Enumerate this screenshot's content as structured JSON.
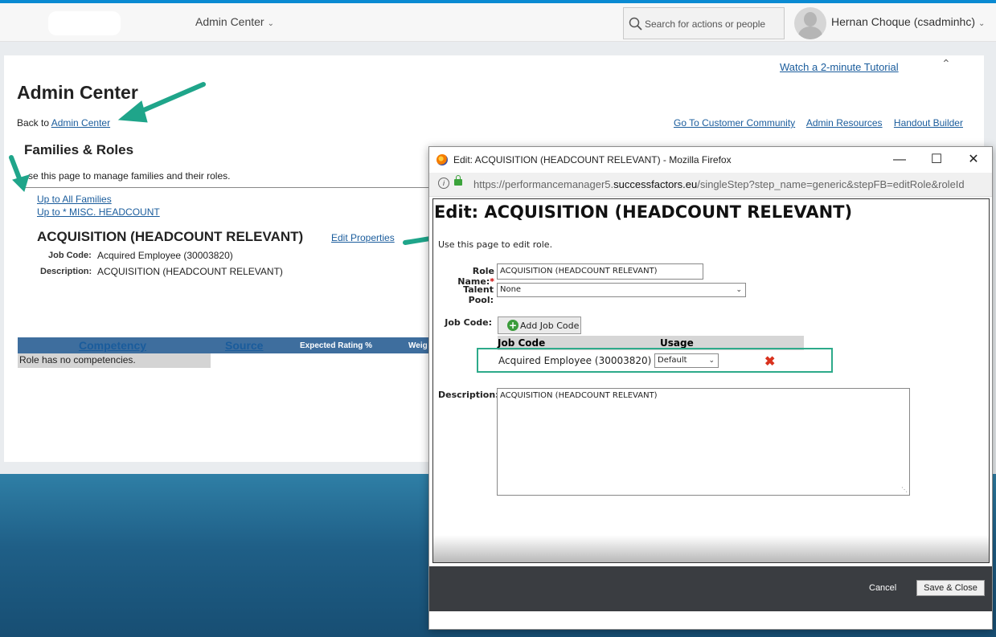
{
  "header": {
    "admin_menu": "Admin Center",
    "search_placeholder": "Search for actions or people",
    "user": "Hernan Choque (csadminhc)"
  },
  "panel": {
    "tutorial": "Watch a 2-minute Tutorial",
    "title": "Admin Center",
    "back_prefix": "Back to ",
    "back_link": "Admin Center",
    "links": [
      "Go To Customer Community",
      "Admin Resources",
      "Handout Builder"
    ],
    "families_title": "Families & Roles",
    "families_desc": "se this page to manage families and their roles.",
    "up_all": "Up to All Families",
    "up_misc": "Up to * MISC. HEADCOUNT",
    "role_title": "ACQUISITION (HEADCOUNT RELEVANT)",
    "edit_properties": "Edit Properties",
    "job_code_label": "Job Code:",
    "job_code_value": "Acquired Employee (30003820)",
    "description_label": "Description:",
    "description_value": "ACQUISITION (HEADCOUNT RELEVANT)",
    "table_headers": [
      "Competency",
      "Source",
      "Expected Rating %",
      "Weig"
    ],
    "no_competencies": "Role has no competencies."
  },
  "popup": {
    "window_title": "Edit: ACQUISITION (HEADCOUNT RELEVANT) - Mozilla Firefox",
    "url_prefix": "https://performancemanager5.",
    "url_domain": "successfactors.eu",
    "url_suffix": "/singleStep?step_name=generic&stepFB=editRole&roleId",
    "heading": "Edit: ACQUISITION (HEADCOUNT RELEVANT)",
    "desc": "Use this page to edit role.",
    "role_name_label": "Role Name:",
    "required_mark": "*",
    "role_name_value": "ACQUISITION (HEADCOUNT RELEVANT)",
    "talent_pool_label": "Talent Pool:",
    "talent_pool_value": "None",
    "job_code_label": "Job Code:",
    "add_job_code": "Add Job Code",
    "jc_col_job_code": "Job Code",
    "jc_col_usage": "Usage",
    "jc_row_value": "Acquired Employee (30003820)",
    "jc_row_usage": "Default",
    "description_label": "Description:",
    "description_value": "ACQUISITION (HEADCOUNT RELEVANT)",
    "cancel": "Cancel",
    "save_close": "Save & Close"
  },
  "colors": {
    "accent_arrow": "#1fa58a",
    "link": "#1a5c9c",
    "header_band": "#3e6e9e"
  }
}
